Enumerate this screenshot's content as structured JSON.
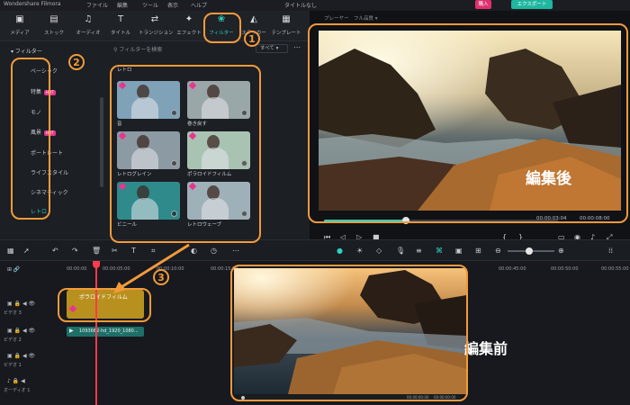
{
  "app": {
    "title": "Wondershare Filmora",
    "project_title": "タイトルなし",
    "buy_label": "購入",
    "export_label": "エクスポート"
  },
  "menu": [
    "ファイル",
    "編集",
    "ツール",
    "表示",
    "ヘルプ"
  ],
  "toolbar": {
    "tabs": [
      {
        "label": "メディア",
        "icon": "media-icon"
      },
      {
        "label": "ストック",
        "icon": "stock-icon"
      },
      {
        "label": "オーディオ",
        "icon": "audio-icon"
      },
      {
        "label": "タイトル",
        "icon": "title-icon"
      },
      {
        "label": "トランジション",
        "icon": "transition-icon"
      },
      {
        "label": "エフェクト",
        "icon": "effect-icon"
      },
      {
        "label": "フィルター",
        "icon": "filter-icon",
        "active": true
      },
      {
        "label": "ステッカー",
        "icon": "sticker-icon"
      },
      {
        "label": "テンプレート",
        "icon": "template-icon"
      }
    ]
  },
  "filter_nav": {
    "header": "フィルター",
    "items": [
      {
        "label": "ベーシック"
      },
      {
        "label": "特集",
        "badge": "HOT"
      },
      {
        "label": "モノ"
      },
      {
        "label": "風景",
        "badge": "HOT"
      },
      {
        "label": "ポートレート"
      },
      {
        "label": "ライフスタイル"
      },
      {
        "label": "シネマティック"
      },
      {
        "label": "レトロ",
        "selected": true
      }
    ]
  },
  "filter_panel": {
    "search_placeholder": "フィルターを検索",
    "sort_label": "すべて",
    "section": "レトロ",
    "thumbnails": [
      {
        "label": "音",
        "color": "#7fa2b8"
      },
      {
        "label": "巻き戻す",
        "color": "#9aa7a8"
      },
      {
        "label": "レトログレイン",
        "color": "#8c9aa4"
      },
      {
        "label": "ポラロイドフィルム",
        "color": "#a9c3b3"
      },
      {
        "label": "ビニール",
        "color": "#2f8a8c"
      },
      {
        "label": "レトロウェーブ",
        "color": "#9fb1b8"
      }
    ]
  },
  "preview": {
    "tabs": [
      "プレーヤー",
      "フル品質"
    ],
    "current_time": "00:00:03:04",
    "total_time": "00:00:08:00",
    "progress": 0.35,
    "overlay_label": "編集後"
  },
  "timeline": {
    "ruler": [
      "00:00:00",
      "00:00:05:00",
      "00:00:10:00",
      "00:00:15:00",
      "00:00:45:00",
      "00:00:50:00",
      "00:00:55:00"
    ],
    "tracks": [
      {
        "name": "ビデオ 3"
      },
      {
        "name": "ビデオ 2"
      },
      {
        "name": "ビデオ 1"
      },
      {
        "name": "オーディオ 1"
      }
    ],
    "filter_clip_label": "ポラロイドフィルム",
    "video_clip_label": "1093662-hd_1920_1080..."
  },
  "before_preview": {
    "overlay_label": "編集前",
    "time_left": "00:00:00:00",
    "time_right": "00:00:00:00"
  },
  "annotations": [
    "1",
    "2",
    "3"
  ]
}
